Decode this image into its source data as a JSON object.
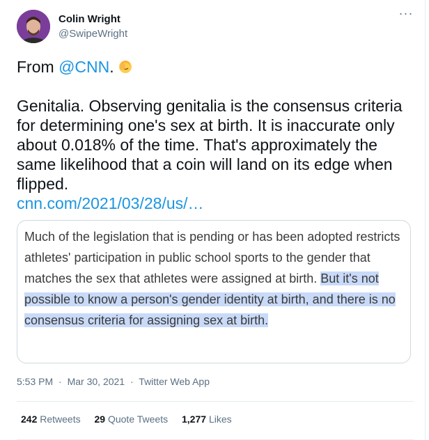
{
  "author": {
    "name": "Colin Wright",
    "handle": "@SwipeWright"
  },
  "tweet": {
    "line1_prefix": "From ",
    "mention": "@CNN",
    "line1_suffix": ".",
    "emoji": "facepalm-emoji",
    "body": "Genitalia. Observing genitalia is the consensus criteria for determining one's sex at birth. It is inaccurate only about 0.018% of the time. That's approximately the same likelihood that a coin will land on its edge when flipped.",
    "link": "cnn.com/2021/03/28/us/…"
  },
  "quote": {
    "plain": "Much of the legislation that is pending or has been adopted restricts athletes' participation in public school sports to the gender that matches the sex that athletes were assigned at birth. ",
    "highlighted": "But it's not possible to know a person's gender identity at birth, and there is no consensus criteria for assigning sex at birth."
  },
  "meta": {
    "time": "5:53 PM",
    "dot": "·",
    "date": "Mar 30, 2021",
    "source": "Twitter Web App"
  },
  "stats": {
    "retweets_count": "242",
    "retweets_label": "Retweets",
    "quotes_count": "29",
    "quotes_label": "Quote Tweets",
    "likes_count": "1,277",
    "likes_label": "Likes"
  },
  "more_icon": "more-dots-icon",
  "colors": {
    "link": "#1b95e0",
    "highlight": "#c9daf8",
    "secondary_text": "#5b7083"
  }
}
